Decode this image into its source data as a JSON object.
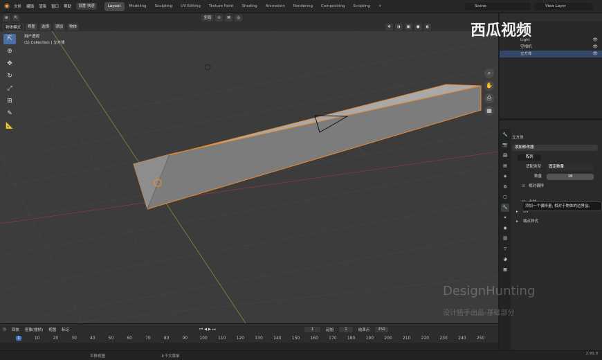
{
  "topbar": {
    "menus": [
      "文件",
      "编辑",
      "渲染",
      "窗口",
      "帮助"
    ],
    "workspace_label": "设置·快速",
    "tabs": [
      "Layout",
      "Modeling",
      "Sculpting",
      "UV Editing",
      "Texture Paint",
      "Shading",
      "Animation",
      "Rendering",
      "Compositing",
      "Scripting"
    ],
    "active_tab": "Layout",
    "scene": "Scene",
    "view_layer": "View Layer"
  },
  "viewport": {
    "mode": "物体模式",
    "menu": [
      "视图",
      "选择",
      "添加",
      "物体"
    ],
    "orientation": "全局",
    "view_name": "用户透视",
    "collection": "(1) Collection | 立方体"
  },
  "outliner": {
    "items": [
      {
        "label": "Light",
        "selected": false
      },
      {
        "label": "空相机",
        "selected": false
      },
      {
        "label": "立方体",
        "selected": true
      }
    ]
  },
  "properties": {
    "object_name": "立方体",
    "add_modifier": "添加修改器",
    "modifier_name": "阵列",
    "fit_type_label": "适配类型",
    "fit_type_value": "固定数量",
    "count_label": "数量",
    "count_value": "16",
    "relative_offset_label": "相对偏移",
    "relative_offset_checked": true,
    "merge_label": "合并",
    "uv_label": "UV",
    "caps_label": "端点样式",
    "tooltip": "添加一个偏移量, 相对于物体的边界盒。"
  },
  "timeline": {
    "menu": [
      "回放",
      "抠像(插帧)",
      "视图",
      "标记"
    ],
    "current_frame": "1",
    "start_label": "起始",
    "start_value": "1",
    "end_label": "结束点",
    "end_value": "250",
    "frame_labels": [
      "1",
      "10",
      "20",
      "30",
      "40",
      "50",
      "60",
      "70",
      "80",
      "90",
      "100",
      "110",
      "120",
      "130",
      "140",
      "150",
      "160",
      "170",
      "180",
      "190",
      "200",
      "210",
      "220",
      "230",
      "240",
      "250"
    ]
  },
  "statusbar": {
    "left": "平移视图",
    "middle": "上下文菜单",
    "version": "2.91.0"
  },
  "overlay": {
    "brand": "西瓜视频",
    "watermark": "DesignHunting",
    "watermark_sub": "设计猎手出品-基础部分"
  }
}
